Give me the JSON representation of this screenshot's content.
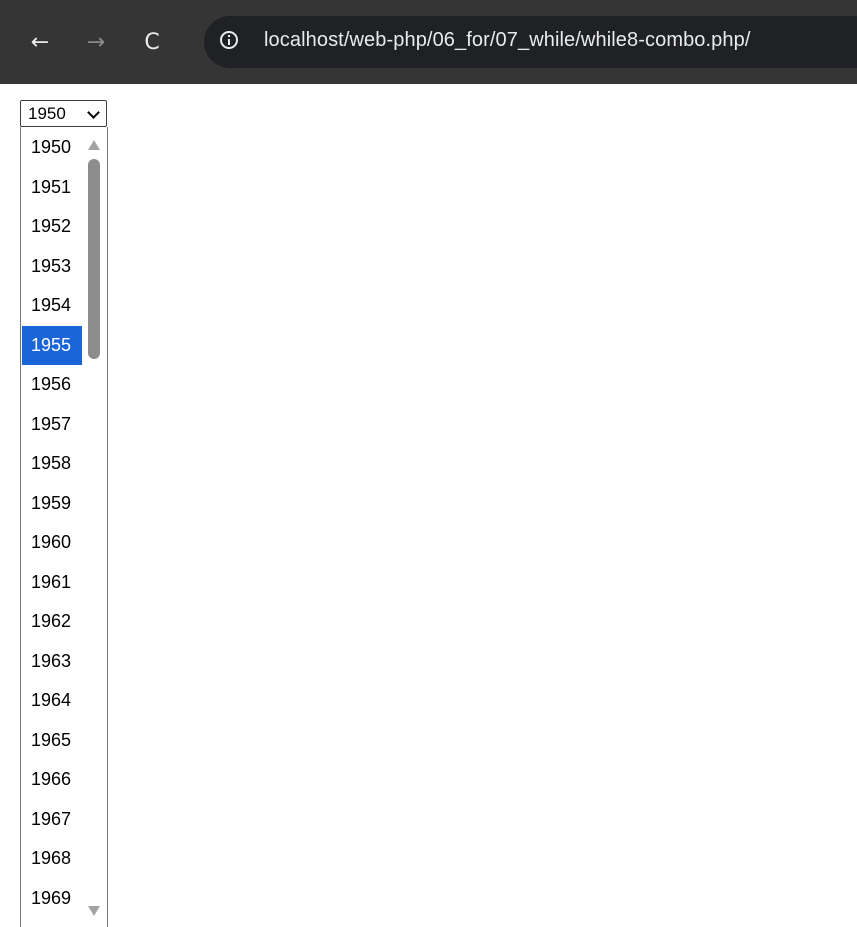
{
  "browser": {
    "address": "localhost/web-php/06_for/07_while/while8-combo.php/",
    "back_icon": "←",
    "forward_icon": "→",
    "reload_icon": "C",
    "colors": {
      "toolbar": "#353535",
      "omnibox": "#202124",
      "text": "#e8eaed"
    }
  },
  "year_select": {
    "value": "1950",
    "highlighted": "1955",
    "options": [
      "1950",
      "1951",
      "1952",
      "1953",
      "1954",
      "1955",
      "1956",
      "1957",
      "1958",
      "1959",
      "1960",
      "1961",
      "1962",
      "1963",
      "1964",
      "1965",
      "1966",
      "1967",
      "1968",
      "1969"
    ],
    "colors": {
      "highlight": "#1a66d8",
      "scroll_thumb": "#8d8d8d"
    }
  }
}
